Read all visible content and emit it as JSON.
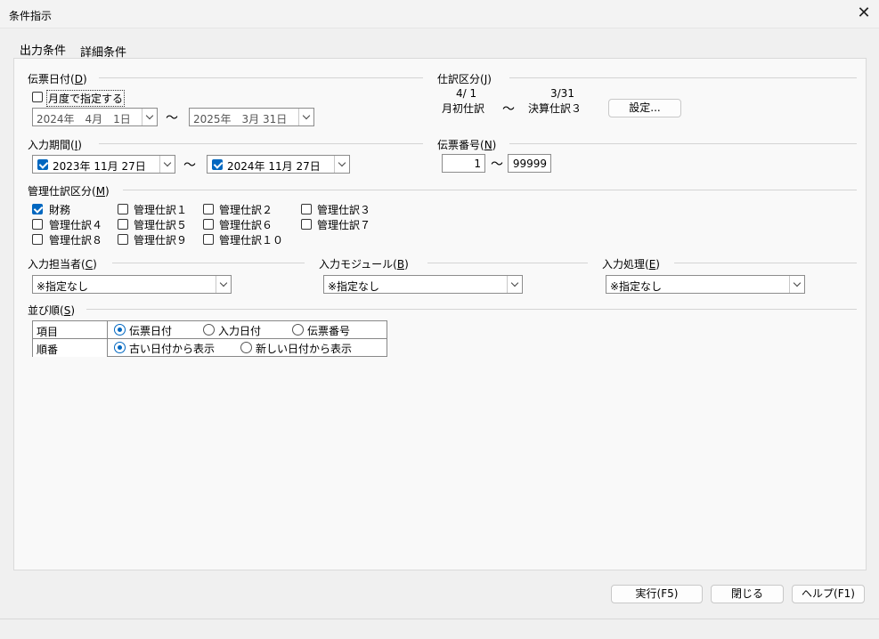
{
  "window": {
    "title": "条件指示",
    "close_glyph": "✕"
  },
  "tabs": [
    {
      "label": "出力条件"
    },
    {
      "label": "詳細条件"
    }
  ],
  "denpyo_date": {
    "group_label": "伝票日付(",
    "group_key": "D",
    "group_close": ")",
    "monthly_checkbox_label": "月度で指定する",
    "monthly_checked": false,
    "from": "2024年　4月　1日",
    "tilde": "～",
    "to": "2025年　3月 31日"
  },
  "shiwake_kubun": {
    "group_label": "仕訳区分(",
    "group_key": "J",
    "group_close": ")",
    "from_date": "4/ 1",
    "from_label": "月初仕訳",
    "tilde": "～",
    "to_date": "3/31",
    "to_label": "決算仕訳３",
    "settings_button": "設定..."
  },
  "input_period": {
    "group_label": "入力期間(",
    "group_key": "I",
    "group_close": ")",
    "from_checked": true,
    "from": "2023年 11月 27日",
    "tilde": "～",
    "to_checked": true,
    "to": "2024年 11月 27日"
  },
  "denpyo_number": {
    "group_label": "伝票番号(",
    "group_key": "N",
    "group_close": ")",
    "from": "1",
    "tilde": "～",
    "to": "99999"
  },
  "kanri_kubun": {
    "group_label": "管理仕訳区分(",
    "group_key": "M",
    "group_close": ")",
    "items": [
      {
        "label": "財務",
        "checked": true
      },
      {
        "label": "管理仕訳１",
        "checked": false
      },
      {
        "label": "管理仕訳２",
        "checked": false
      },
      {
        "label": "管理仕訳３",
        "checked": false
      },
      {
        "label": "管理仕訳４",
        "checked": false
      },
      {
        "label": "管理仕訳５",
        "checked": false
      },
      {
        "label": "管理仕訳６",
        "checked": false
      },
      {
        "label": "管理仕訳７",
        "checked": false
      },
      {
        "label": "管理仕訳８",
        "checked": false
      },
      {
        "label": "管理仕訳９",
        "checked": false
      },
      {
        "label": "管理仕訳１０",
        "checked": false
      }
    ]
  },
  "input_person": {
    "group_label": "入力担当者(",
    "group_key": "C",
    "group_close": ")",
    "value": "※指定なし"
  },
  "input_module": {
    "group_label": "入力モジュール(",
    "group_key": "B",
    "group_close": ")",
    "value": "※指定なし"
  },
  "input_process": {
    "group_label": "入力処理(",
    "group_key": "E",
    "group_close": ")",
    "value": "※指定なし"
  },
  "sort": {
    "group_label": "並び順(",
    "group_key": "S",
    "group_close": ")",
    "rows": [
      {
        "header": "項目",
        "options": [
          {
            "label": "伝票日付",
            "selected": true
          },
          {
            "label": "入力日付",
            "selected": false
          },
          {
            "label": "伝票番号",
            "selected": false
          }
        ]
      },
      {
        "header": "順番",
        "options": [
          {
            "label": "古い日付から表示",
            "selected": true
          },
          {
            "label": "新しい日付から表示",
            "selected": false
          }
        ]
      }
    ]
  },
  "footer": {
    "run_button": "実行(F5)",
    "close_button": "閉じる",
    "help_button": "ヘルプ(F1)"
  }
}
